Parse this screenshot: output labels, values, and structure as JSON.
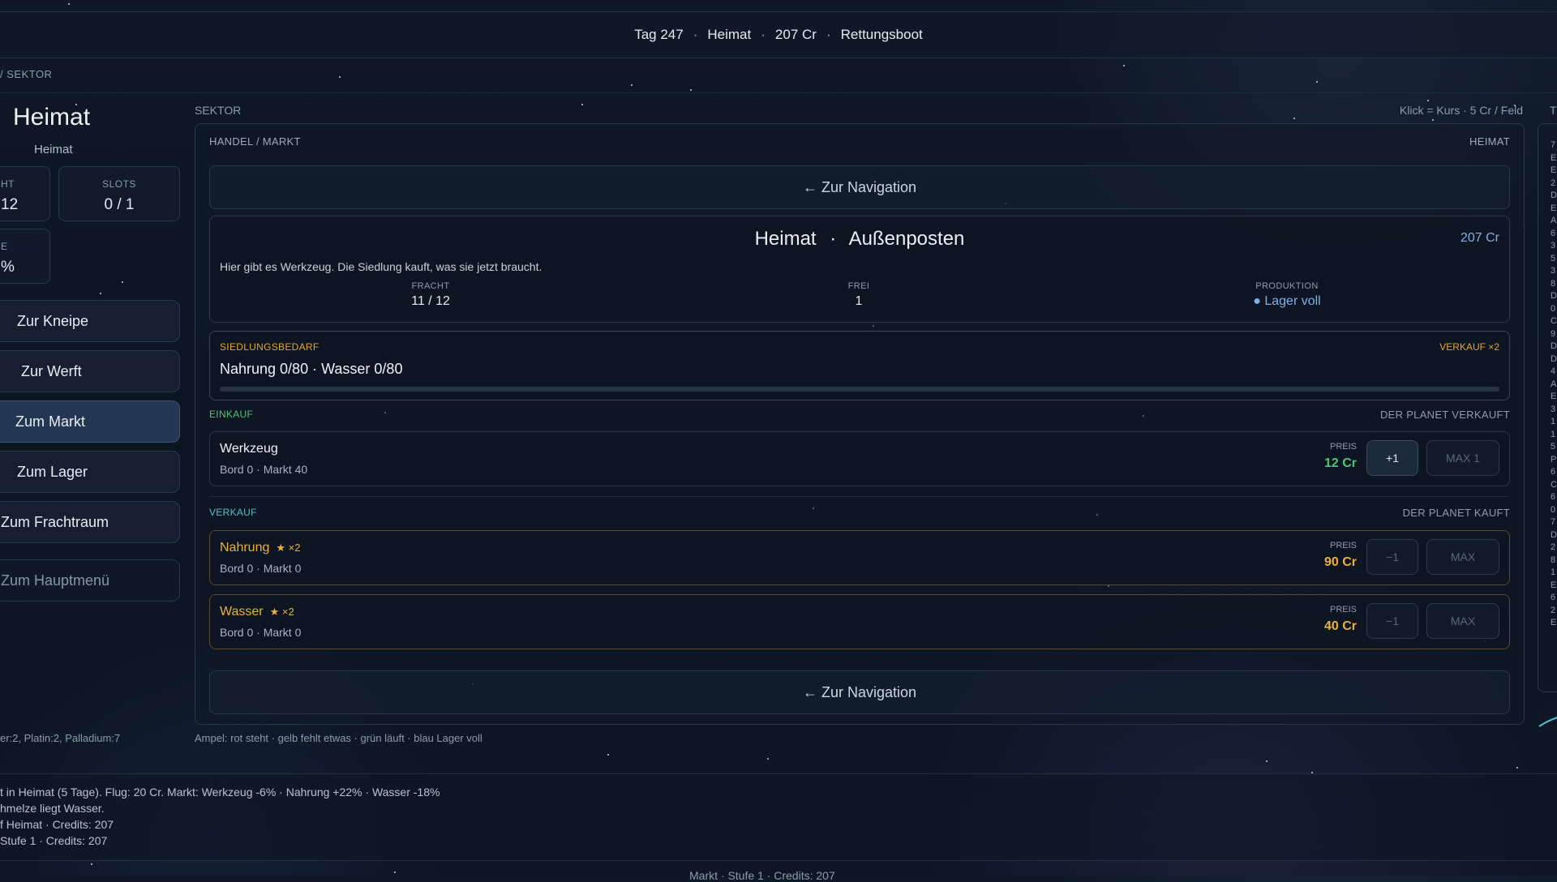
{
  "topbar": {
    "day": "Tag 247",
    "location": "Heimat",
    "credits": "207 Cr",
    "ship": "Rettungsboot"
  },
  "breadcrumb": "/ SEKTOR",
  "left": {
    "title": "Heimat",
    "subtitle": "Heimat",
    "stats": [
      {
        "label": "HT",
        "value": "12"
      },
      {
        "label": "SLOTS",
        "value": "0 / 1"
      },
      {
        "label": "E",
        "value": "%"
      }
    ],
    "nav": [
      "Zur Kneipe",
      "Zur Werft",
      "Zum Markt",
      "Zum Lager",
      "Zum Frachtraum",
      "Zum Hauptmenü"
    ],
    "resources": "er:2, Platin:2, Palladium:7"
  },
  "main": {
    "section_label": "SEKTOR",
    "hint": "Klick = Kurs · 5 Cr / Feld",
    "hint_cut": "T",
    "header_left": "HANDEL / MARKT",
    "header_right": "HEIMAT",
    "back_label": "← Zur Navigation",
    "outpost": {
      "name": "Heimat",
      "type": "Außenposten",
      "credits": "207 Cr",
      "description": "Hier gibt es Werkzeug. Die Siedlung kauft, was sie jetzt braucht.",
      "fracht_label": "FRACHT",
      "fracht_value": "11 / 12",
      "frei_label": "FREI",
      "frei_value": "1",
      "produktion_label": "PRODUKTION",
      "produktion_value": "● Lager voll"
    },
    "need": {
      "label": "SIEDLUNGSBEDARF",
      "bonus": "VERKAUF ×2",
      "text": "Nahrung 0/80 · Wasser 0/80",
      "progress": 0
    },
    "buy": {
      "label": "EINKAUF",
      "right": "DER PLANET VERKAUFT",
      "items": [
        {
          "name": "Werkzeug",
          "sub": "Bord 0 · Markt 40",
          "price_label": "PREIS",
          "price": "12 Cr",
          "btn1": "+1",
          "btn2": "MAX 1"
        }
      ]
    },
    "sell": {
      "label": "VERKAUF",
      "right": "DER PLANET KAUFT",
      "items": [
        {
          "name": "Nahrung",
          "bonus": "★ ×2",
          "sub": "Bord 0 · Markt 0",
          "price_label": "PREIS",
          "price": "90 Cr",
          "btn1": "−1",
          "btn2": "MAX"
        },
        {
          "name": "Wasser",
          "bonus": "★ ×2",
          "sub": "Bord 0 · Markt 0",
          "price_label": "PREIS",
          "price": "40 Cr",
          "btn1": "−1",
          "btn2": "MAX"
        }
      ]
    },
    "legend": "Ampel: rot steht · gelb fehlt etwas · grün läuft · blau Lager voll"
  },
  "log": [
    "t in Heimat (5 Tage). Flug: 20 Cr. Markt: Werkzeug -6% · Nahrung +22% · Wasser -18%",
    "hmelze liegt Wasser.",
    "f Heimat · Credits: 207",
    "Stufe 1 · Credits: 207"
  ],
  "footer_cut": "Markt · Stufe 1 · Credits: 207",
  "right_column": [
    "7",
    "E",
    "E",
    "2",
    "D",
    "E",
    "A",
    "6",
    "3",
    "5",
    "3",
    "8",
    "D",
    "0",
    "C",
    "9",
    "D",
    "D",
    "4",
    "A",
    "E",
    "3",
    "1",
    "1",
    "5",
    "P",
    "6",
    "C",
    "6",
    "0",
    "7",
    "D",
    "2",
    "8",
    "1",
    "E",
    "6",
    "2",
    "E"
  ],
  "colors": {
    "gold": "#e9b13c",
    "green": "#4cc47a",
    "blue": "#7fb0e6",
    "teal": "#4fc3c9"
  }
}
